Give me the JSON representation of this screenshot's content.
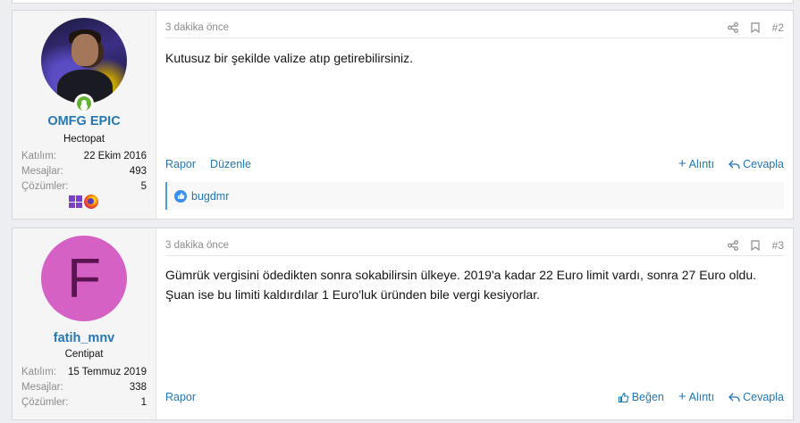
{
  "posts": [
    {
      "user": {
        "name": "OMFG EPIC",
        "title": "Hectopat",
        "avatar_type": "photo",
        "online": true,
        "stats": [
          {
            "label": "Katılım:",
            "value": "22 Ekim 2016"
          },
          {
            "label": "Mesajlar:",
            "value": "493"
          },
          {
            "label": "Çözümler:",
            "value": "5"
          }
        ],
        "os_icons": [
          "windows-icon",
          "firefox-icon"
        ]
      },
      "time": "3 dakika önce",
      "number": "#2",
      "body": [
        "Kutusuz bir şekilde valize atıp getirebilirsiniz."
      ],
      "actions_left": [
        "Rapor",
        "Düzenle"
      ],
      "actions_right": [
        "Alıntı",
        "Cevapla"
      ],
      "reaction_user": "bugdmr"
    },
    {
      "user": {
        "name": "fatih_mnv",
        "title": "Centipat",
        "avatar_type": "letter",
        "avatar_letter": "F",
        "avatar_color": "#d561c4",
        "stats": [
          {
            "label": "Katılım:",
            "value": "15 Temmuz 2019"
          },
          {
            "label": "Mesajlar:",
            "value": "338"
          },
          {
            "label": "Çözümler:",
            "value": "1"
          }
        ]
      },
      "time": "3 dakika önce",
      "number": "#3",
      "body": [
        "Gümrük vergisini ödedikten sonra sokabilirsin ülkeye. 2019'a kadar 22 Euro limit vardı, sonra 27 Euro oldu.",
        "Şuan ise bu limiti kaldırdılar 1 Euro'luk üründen bile vergi kesiyorlar."
      ],
      "actions_left": [
        "Rapor"
      ],
      "actions_right": [
        "Beğen",
        "Alıntı",
        "Cevapla"
      ]
    }
  ],
  "colors": {
    "link": "#2577b1",
    "accent_bar": "#4a9fd6",
    "online": "#63b233"
  }
}
